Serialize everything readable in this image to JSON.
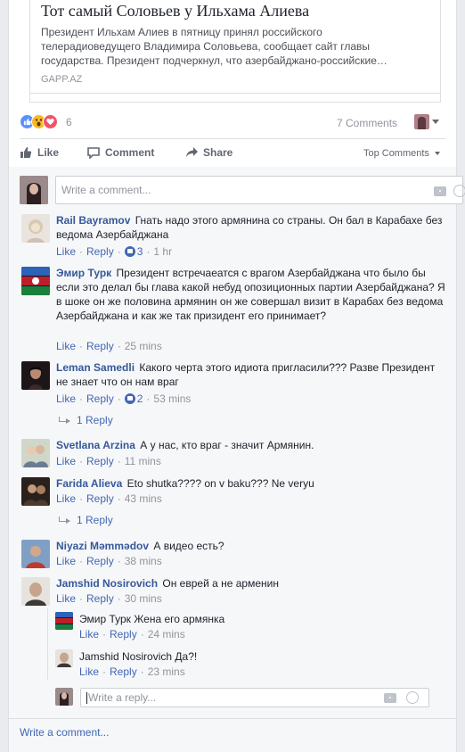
{
  "link_preview": {
    "title": "Тот самый Соловьев у Ильхама Алиева",
    "description": "Президент Ильхам Алиев в пятницу принял российского телерадиоведущего Владимира Соловьева, сообщает сайт главы государства. Президент подчеркнул, что азербайджано-российские…",
    "domain": "GAPP.AZ"
  },
  "reactions": {
    "count": "6",
    "icons": [
      "like-icon",
      "wow-icon",
      "love-icon"
    ],
    "comments_count": "7 Comments"
  },
  "actions": {
    "like": "Like",
    "comment": "Comment",
    "share": "Share",
    "top_comments": "Top Comments"
  },
  "composer": {
    "placeholder": "Write a comment..."
  },
  "comments": [
    {
      "author": "Rail Bayramov",
      "text": "Гнать надо этого армянина со страны. Он бал в Карабахе без ведома Азербайджана",
      "like": "Like",
      "reply": "Reply",
      "likes": "3",
      "time": "1 hr"
    },
    {
      "author": "Эмир Турк",
      "text": "Президент встречаеатся с врагом Азербайджана что было бы если это делал бы глава какой небуд опозиционных партии Азербайджана? Я в шоке он же половина армянин он же совершал визит в Карабах без ведома Азербайджана и как же так призидент его принимает?",
      "like": "Like",
      "reply": "Reply",
      "time": "25 mins"
    },
    {
      "author": "Leman Samedli",
      "text": "Какого черта этого идиота пригласили??? Разве Президент не знает что он нам враг",
      "like": "Like",
      "reply": "Reply",
      "likes": "2",
      "time": "53 mins",
      "replies_link": "1 Reply"
    },
    {
      "author": "Svetlana Arzina",
      "text": "А у нас, кто враг - значит Армянин.",
      "like": "Like",
      "reply": "Reply",
      "time": "11 mins"
    },
    {
      "author": "Farida Alieva",
      "text": "Eto shutka???? on v baku??? Ne veryu",
      "like": "Like",
      "reply": "Reply",
      "time": "43 mins",
      "replies_link": "1 Reply"
    },
    {
      "author": "Niyazi Məmmədov",
      "text": "А видео есть?",
      "like": "Like",
      "reply": "Reply",
      "time": "38 mins"
    },
    {
      "author": "Jamshid Nosirovich",
      "text": "Он еврей а не арменин",
      "like": "Like",
      "reply": "Reply",
      "time": "30 mins"
    }
  ],
  "replies": [
    {
      "author": "Эмир Турк",
      "text": "Жена его армянка",
      "like": "Like",
      "reply": "Reply",
      "time": "24 mins"
    },
    {
      "author": "Jamshid Nosirovich",
      "text": "Да?!",
      "like": "Like",
      "reply": "Reply",
      "time": "23 mins"
    }
  ],
  "reply_composer": {
    "placeholder": "Write a reply..."
  },
  "footer": {
    "write_comment": "Write a comment..."
  },
  "colors": {
    "link_blue": "#365899",
    "action_blue": "#4267b2",
    "meta_gray": "#90949c",
    "panel_bg": "#f6f7f9",
    "like_blue": "#5890ff",
    "wow_yellow": "#f7b928",
    "love_red": "#f25268"
  }
}
